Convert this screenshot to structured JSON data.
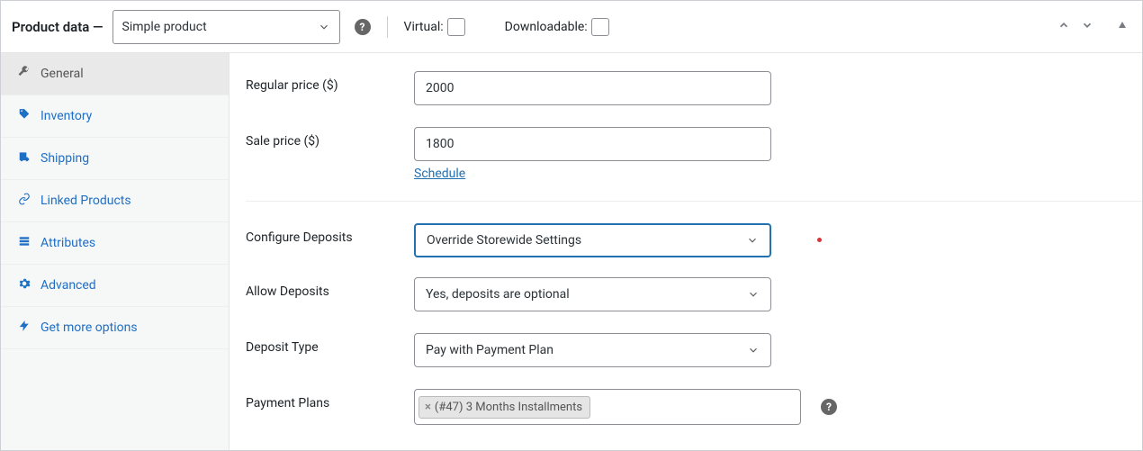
{
  "panel": {
    "title": "Product data —",
    "product_type": "Simple product",
    "virtual_label": "Virtual:",
    "downloadable_label": "Downloadable:"
  },
  "tabs": [
    {
      "icon": "wrench",
      "label": "General",
      "active": true
    },
    {
      "icon": "tag",
      "label": "Inventory",
      "active": false
    },
    {
      "icon": "truck",
      "label": "Shipping",
      "active": false
    },
    {
      "icon": "link",
      "label": "Linked Products",
      "active": false
    },
    {
      "icon": "list",
      "label": "Attributes",
      "active": false
    },
    {
      "icon": "gear",
      "label": "Advanced",
      "active": false
    },
    {
      "icon": "bolt",
      "label": "Get more options",
      "active": false
    }
  ],
  "fields": {
    "regular_price_label": "Regular price ($)",
    "regular_price": "2000",
    "sale_price_label": "Sale price ($)",
    "sale_price": "1800",
    "schedule": "Schedule",
    "configure_deposits_label": "Configure Deposits",
    "configure_deposits": "Override Storewide Settings",
    "allow_deposits_label": "Allow Deposits",
    "allow_deposits": "Yes, deposits are optional",
    "deposit_type_label": "Deposit Type",
    "deposit_type": "Pay with Payment Plan",
    "payment_plans_label": "Payment Plans",
    "payment_plans_tag": "(#47) 3 Months Installments"
  }
}
